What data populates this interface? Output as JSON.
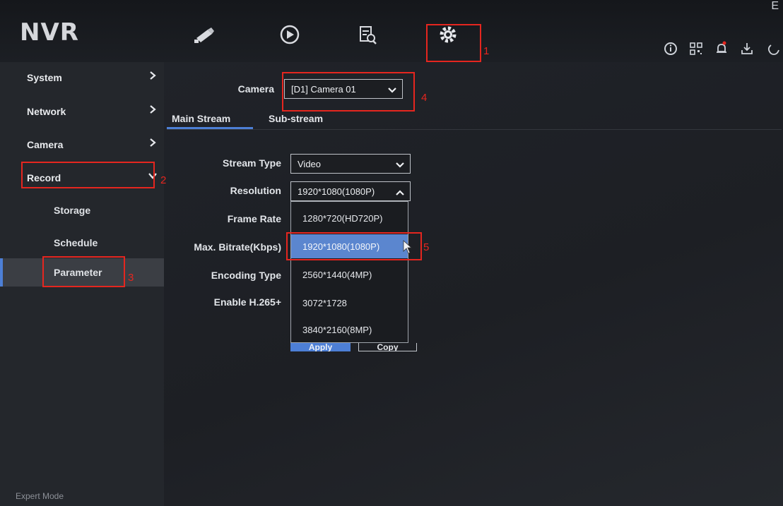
{
  "app": {
    "logo": "NVR",
    "corner_letter": "E"
  },
  "nav": {
    "items": [
      {
        "icon": "camera-icon"
      },
      {
        "icon": "playback-icon"
      },
      {
        "icon": "search-file-icon"
      },
      {
        "icon": "settings-gear-icon",
        "active": true
      }
    ],
    "right_icons": [
      "info-icon",
      "qr-code-icon",
      "alarm-bell-icon",
      "download-icon",
      "power-icon"
    ],
    "accent_color": "#4d7fd6"
  },
  "sidebar": {
    "items": [
      {
        "label": "System"
      },
      {
        "label": "Network"
      },
      {
        "label": "Camera"
      },
      {
        "label": "Record",
        "expanded": true
      }
    ],
    "record_sub": [
      {
        "label": "Storage"
      },
      {
        "label": "Schedule"
      },
      {
        "label": "Parameter",
        "active": true
      }
    ],
    "footer": "Expert Mode"
  },
  "camera_select": {
    "label": "Camera",
    "value": "[D1] Camera 01"
  },
  "tabs": [
    {
      "label": "Main Stream",
      "active": true
    },
    {
      "label": "Sub-stream"
    }
  ],
  "form": {
    "stream_type": {
      "label": "Stream Type",
      "value": "Video"
    },
    "resolution": {
      "label": "Resolution",
      "value": "1920*1080(1080P)",
      "open": true
    },
    "frame_rate": {
      "label": "Frame Rate"
    },
    "max_bitrate": {
      "label": "Max. Bitrate(Kbps)"
    },
    "encoding_type": {
      "label": "Encoding Type"
    },
    "enable_h265": {
      "label": "Enable H.265+"
    }
  },
  "resolution_options": [
    {
      "label": "1280*720(HD720P)"
    },
    {
      "label": "1920*1080(1080P)",
      "selected": true
    },
    {
      "label": "2560*1440(4MP)"
    },
    {
      "label": "3072*1728"
    },
    {
      "label": "3840*2160(8MP)"
    }
  ],
  "buttons": {
    "apply": "Apply",
    "copy": "Copy"
  },
  "annotations": {
    "color": "#e5261f",
    "numbers": [
      "1",
      "2",
      "3",
      "4",
      "5"
    ]
  }
}
